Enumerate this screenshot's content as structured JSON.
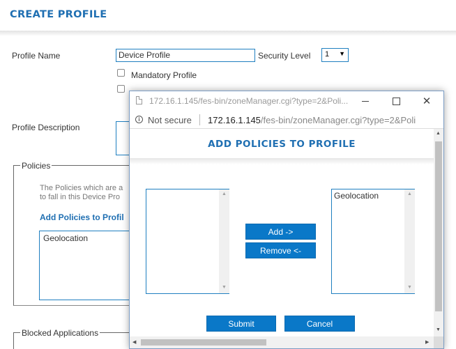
{
  "page": {
    "title": "CREATE PROFILE",
    "profile_name_label": "Profile Name",
    "profile_name_value": "Device Profile",
    "security_level_label": "Security Level",
    "security_level_value": "1",
    "mandatory_profile_label": "Mandatory Profile",
    "profile_description_label": "Profile Description",
    "policies_legend": "Policies",
    "policies_help_line1": "The Policies which are a",
    "policies_help_line2": "to fall in this Device Pro",
    "add_policies_link": "Add Policies to Profil",
    "policies_list": [
      "Geolocation"
    ],
    "blocked_apps_legend": "Blocked Applications"
  },
  "popup": {
    "window_title": "172.16.1.145/fes-bin/zoneManager.cgi?type=2&Poli...",
    "not_secure": "Not secure",
    "url_host": "172.16.1.145",
    "url_path": "/fes-bin/zoneManager.cgi?type=2&Poli",
    "heading": "ADD POLICIES TO PROFILE",
    "available_list": [],
    "selected_list": [
      "Geolocation"
    ],
    "add_button": "Add ->",
    "remove_button": "Remove <-",
    "submit_button": "Submit",
    "cancel_button": "Cancel"
  },
  "colors": {
    "accent": "#1f6fb2",
    "button": "#0a78c8"
  }
}
